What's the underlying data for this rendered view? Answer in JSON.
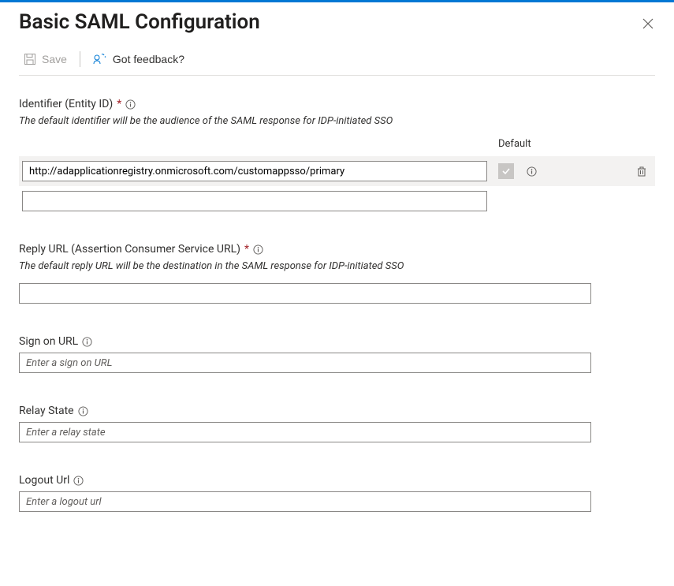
{
  "header": {
    "title": "Basic SAML Configuration"
  },
  "toolbar": {
    "save_label": "Save",
    "feedback_label": "Got feedback?"
  },
  "sections": {
    "identifier": {
      "label": "Identifier (Entity ID)",
      "required": true,
      "help": "The default identifier will be the audience of the SAML response for IDP-initiated SSO",
      "default_header": "Default",
      "rows": [
        {
          "value": "http://adapplicationregistry.onmicrosoft.com/customappsso/primary",
          "default": true
        },
        {
          "value": "",
          "default": false
        }
      ]
    },
    "reply_url": {
      "label": "Reply URL (Assertion Consumer Service URL)",
      "required": true,
      "help": "The default reply URL will be the destination in the SAML response for IDP-initiated SSO",
      "value": ""
    },
    "sign_on": {
      "label": "Sign on URL",
      "placeholder": "Enter a sign on URL",
      "value": ""
    },
    "relay_state": {
      "label": "Relay State",
      "placeholder": "Enter a relay state",
      "value": ""
    },
    "logout": {
      "label": "Logout Url",
      "placeholder": "Enter a logout url",
      "value": ""
    }
  }
}
